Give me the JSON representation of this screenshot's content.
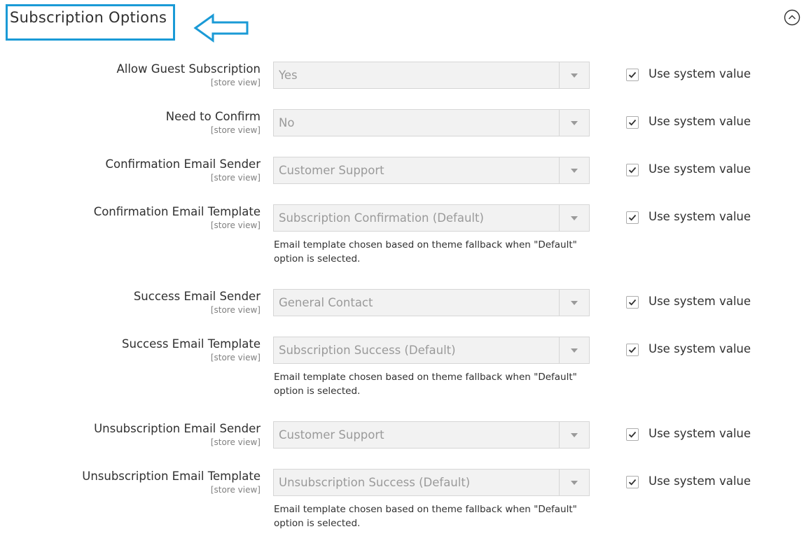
{
  "section": {
    "title": "Subscription Options"
  },
  "accent_color": "#1a9ad6",
  "icons": {
    "annotation": "arrow-left-icon",
    "collapse": "chevron-up-circle-icon",
    "checkbox": "checkmark-icon"
  },
  "fields": [
    {
      "label": "Allow Guest Subscription",
      "scope": "[store view]",
      "value": "Yes",
      "checkbox_label": "Use system value",
      "checked": true,
      "note": ""
    },
    {
      "label": "Need to Confirm",
      "scope": "[store view]",
      "value": "No",
      "checkbox_label": "Use system value",
      "checked": true,
      "note": ""
    },
    {
      "label": "Confirmation Email Sender",
      "scope": "[store view]",
      "value": "Customer Support",
      "checkbox_label": "Use system value",
      "checked": true,
      "note": ""
    },
    {
      "label": "Confirmation Email Template",
      "scope": "[store view]",
      "value": "Subscription Confirmation (Default)",
      "checkbox_label": "Use system value",
      "checked": true,
      "note": "Email template chosen based on theme fallback when \"Default\" option is selected."
    },
    {
      "label": "Success Email Sender",
      "scope": "[store view]",
      "value": "General Contact",
      "checkbox_label": "Use system value",
      "checked": true,
      "note": ""
    },
    {
      "label": "Success Email Template",
      "scope": "[store view]",
      "value": "Subscription Success (Default)",
      "checkbox_label": "Use system value",
      "checked": true,
      "note": "Email template chosen based on theme fallback when \"Default\" option is selected."
    },
    {
      "label": "Unsubscription Email Sender",
      "scope": "[store view]",
      "value": "Customer Support",
      "checkbox_label": "Use system value",
      "checked": true,
      "note": ""
    },
    {
      "label": "Unsubscription Email Template",
      "scope": "[store view]",
      "value": "Unsubscription Success (Default)",
      "checkbox_label": "Use system value",
      "checked": true,
      "note": "Email template chosen based on theme fallback when \"Default\" option is selected."
    }
  ]
}
